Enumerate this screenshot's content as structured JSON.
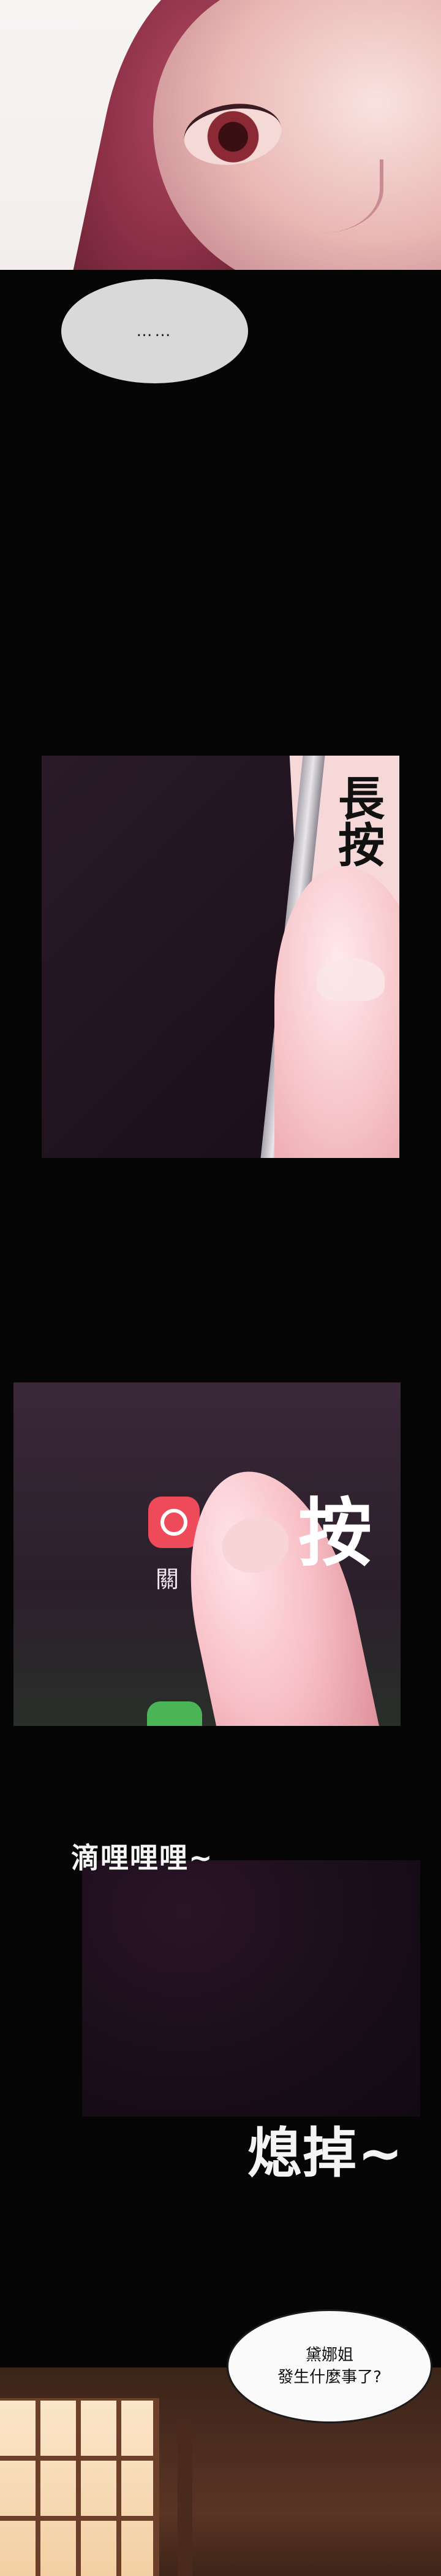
{
  "bubble_1": {
    "text": "……"
  },
  "sfx": {
    "long_press": "長按",
    "press": "按",
    "ringing": "滴哩哩哩~",
    "turn_off": "熄掉~"
  },
  "phone_screen": {
    "app_label_partial": "關"
  },
  "bubble_2": {
    "line1": "黛娜姐",
    "line2": "發生什麼事了?"
  }
}
